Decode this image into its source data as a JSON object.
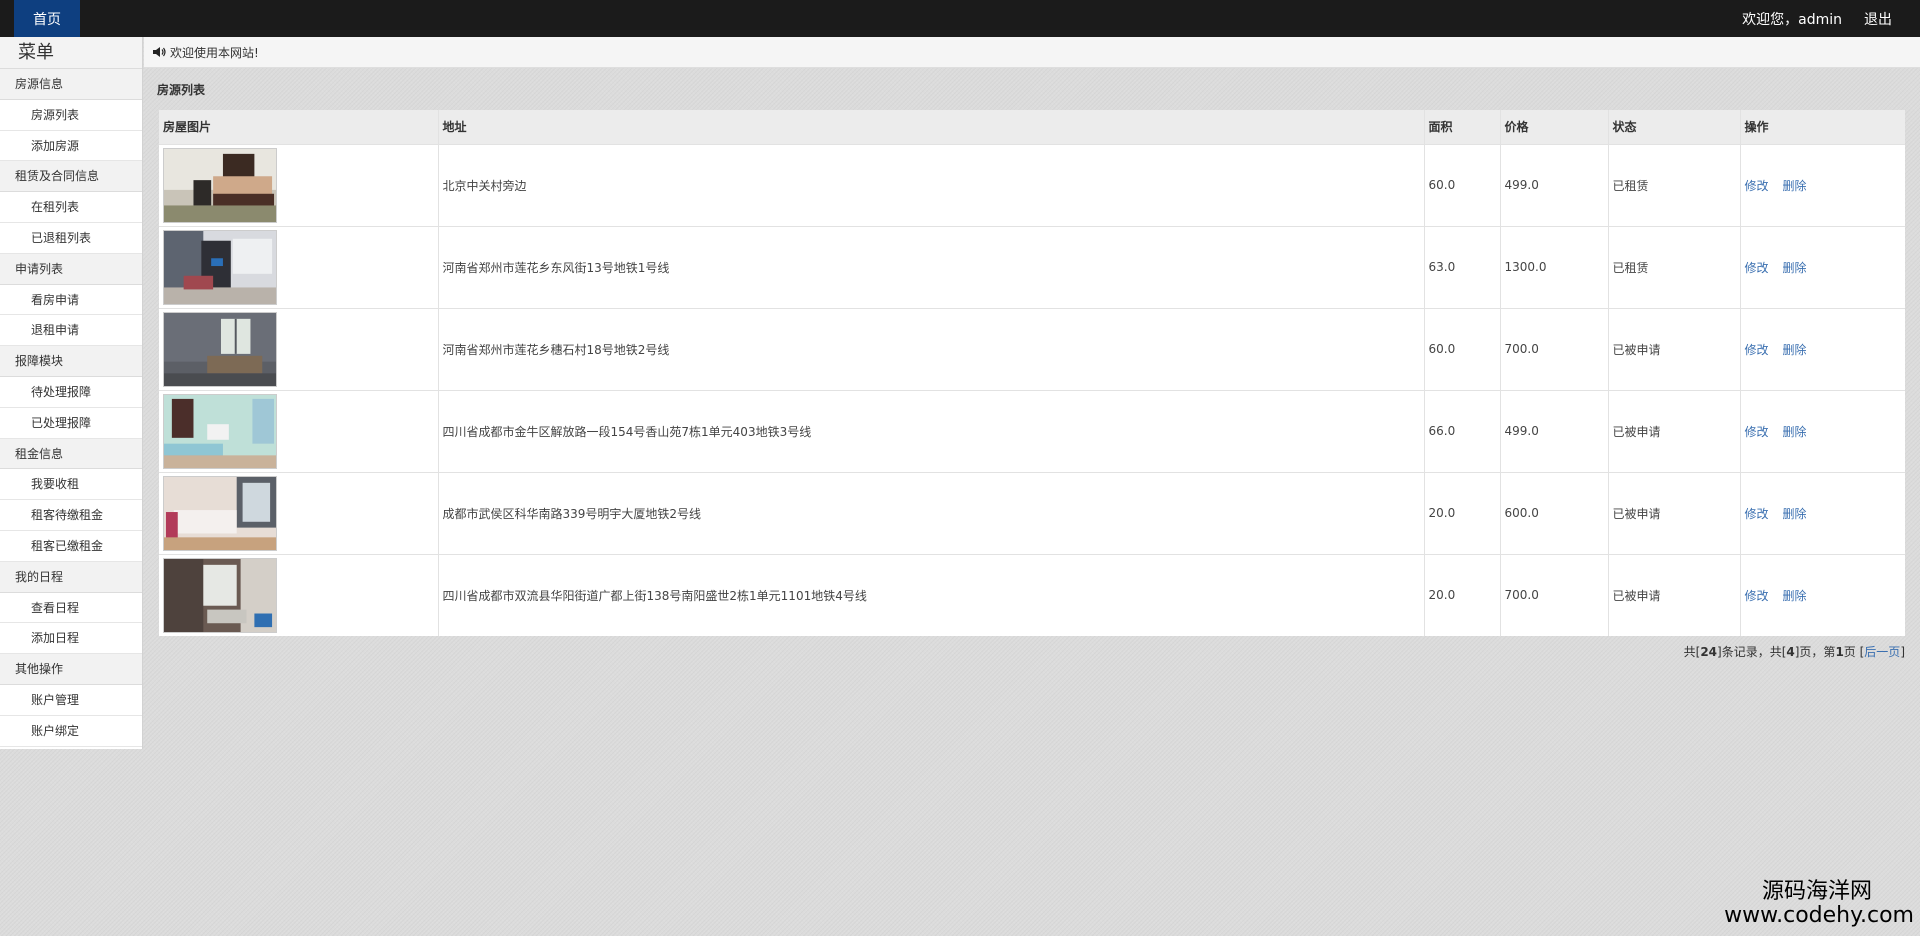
{
  "topbar": {
    "home_label": "首页",
    "greeting": "欢迎您，admin",
    "logout_label": "退出"
  },
  "sidebar": {
    "title": "菜单",
    "groups": [
      {
        "label": "房源信息",
        "items": [
          "房源列表",
          "添加房源"
        ]
      },
      {
        "label": "租赁及合同信息",
        "items": [
          "在租列表",
          "已退租列表"
        ]
      },
      {
        "label": "申请列表",
        "items": [
          "看房申请",
          "退租申请"
        ]
      },
      {
        "label": "报障模块",
        "items": [
          "待处理报障",
          "已处理报障"
        ]
      },
      {
        "label": "租金信息",
        "items": [
          "我要收租",
          "租客待缴租金",
          "租客已缴租金"
        ]
      },
      {
        "label": "我的日程",
        "items": [
          "查看日程",
          "添加日程"
        ]
      },
      {
        "label": "其他操作",
        "items": [
          "账户管理",
          "账户绑定"
        ]
      }
    ]
  },
  "welcome": {
    "icon": "speaker-icon",
    "text": "欢迎使用本网站!"
  },
  "main": {
    "section_title": "房源列表",
    "table": {
      "headers": [
        "房屋图片",
        "地址",
        "面积",
        "价格",
        "状态",
        "操作"
      ],
      "rows": [
        {
          "address": "北京中关村旁边",
          "area": "60.0",
          "price": "499.0",
          "status": "已租赁",
          "edit": "修改",
          "delete": "删除"
        },
        {
          "address": "河南省郑州市莲花乡东风街13号地铁1号线",
          "area": "63.0",
          "price": "1300.0",
          "status": "已租赁",
          "edit": "修改",
          "delete": "删除"
        },
        {
          "address": "河南省郑州市莲花乡穗石村18号地铁2号线",
          "area": "60.0",
          "price": "700.0",
          "status": "已被申请",
          "edit": "修改",
          "delete": "删除"
        },
        {
          "address": "四川省成都市金牛区解放路一段154号香山苑7栋1单元403地铁3号线",
          "area": "66.0",
          "price": "499.0",
          "status": "已被申请",
          "edit": "修改",
          "delete": "删除"
        },
        {
          "address": "成都市武侯区科华南路339号明宇大厦地铁2号线",
          "area": "20.0",
          "price": "600.0",
          "status": "已被申请",
          "edit": "修改",
          "delete": "删除"
        },
        {
          "address": "四川省成都市双流县华阳街道广都上街138号南阳盛世2栋1单元1101地铁4号线",
          "area": "20.0",
          "price": "700.0",
          "status": "已被申请",
          "edit": "修改",
          "delete": "删除"
        }
      ]
    },
    "pager": {
      "p1": "共[",
      "total_records": "24",
      "p2": "]条记录，共[",
      "total_pages": "4",
      "p3": "]页，第",
      "current_page": "1",
      "p4": "页 [",
      "next_label": "后一页",
      "p5": "]"
    }
  },
  "watermark": {
    "line1": "源码海洋网",
    "line2": "www.codehy.com"
  }
}
